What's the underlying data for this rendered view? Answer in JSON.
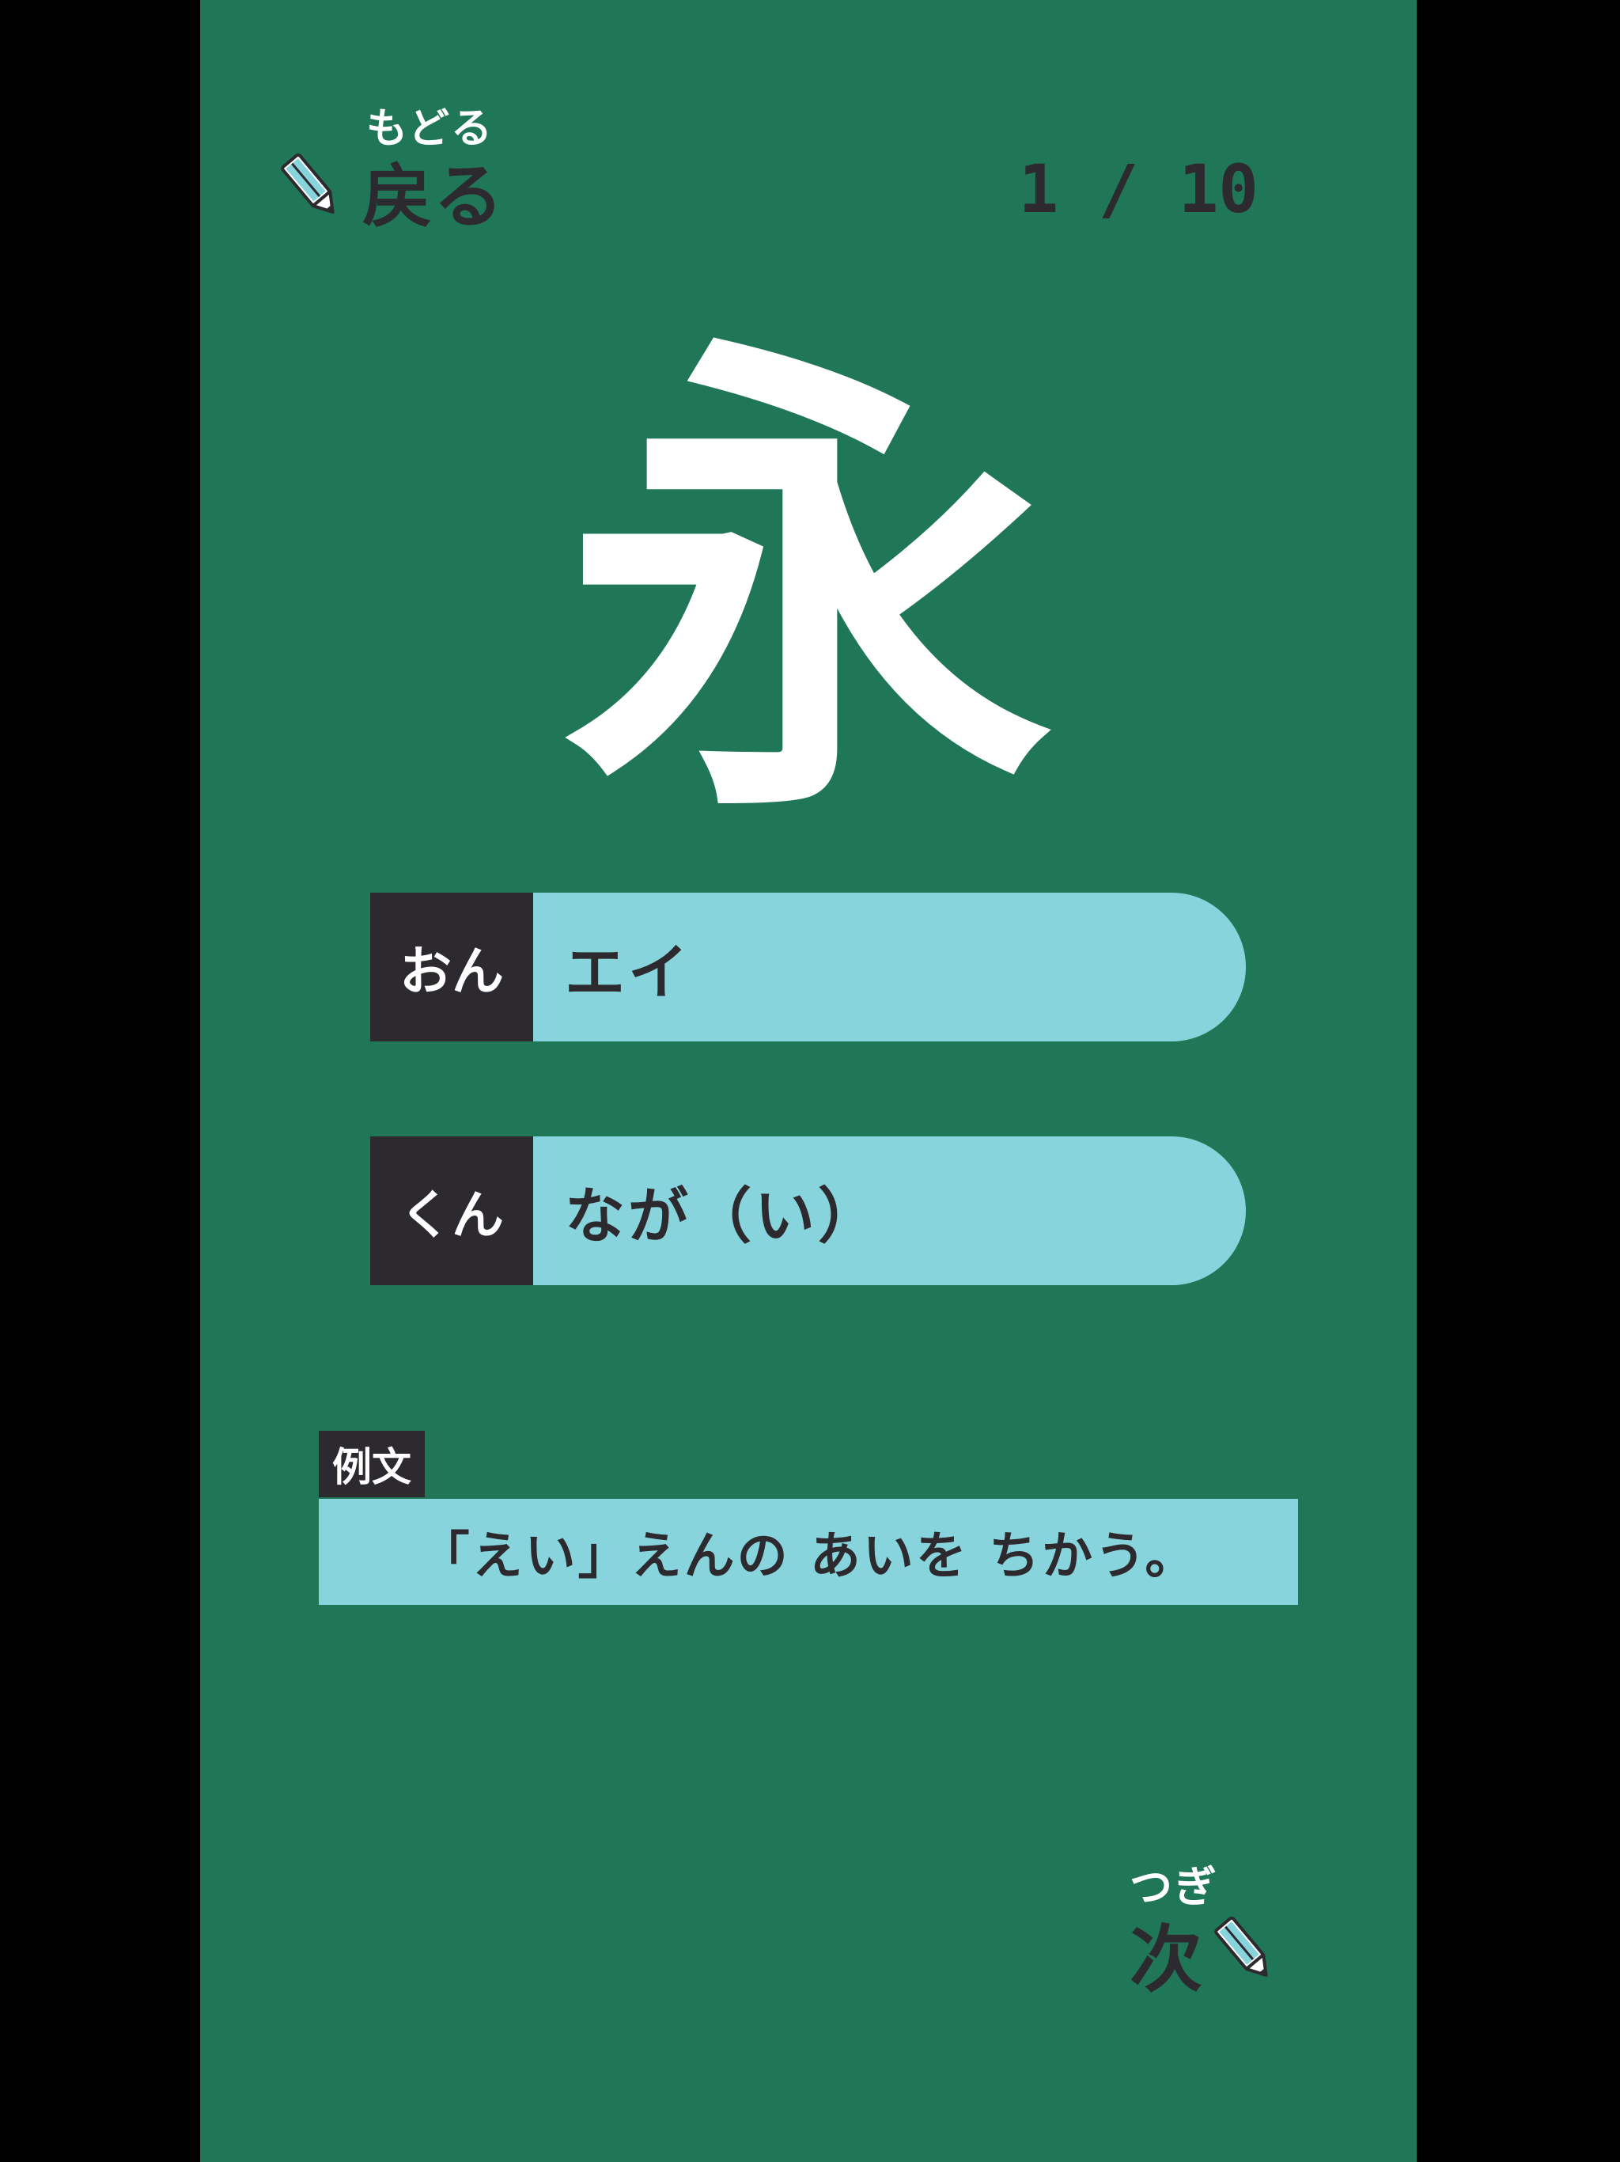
{
  "header": {
    "back_ruby": "もどる",
    "back_label": "戻る",
    "counter": "1 / 10"
  },
  "kanji": "永",
  "readings": {
    "on_tag": "おん",
    "on_value": "エイ",
    "kun_tag": "くん",
    "kun_value": "なが（い）"
  },
  "example": {
    "label": "例文",
    "sentence": "「えい」えんの あいを ちかう。"
  },
  "footer": {
    "next_ruby": "つぎ",
    "next_label": "次"
  },
  "colors": {
    "background": "#207757",
    "dark": "#2c2a2f",
    "light_cyan": "#88d4dc",
    "white": "#ffffff"
  },
  "icons": {
    "back": "pencil-icon",
    "next": "pencil-icon"
  }
}
